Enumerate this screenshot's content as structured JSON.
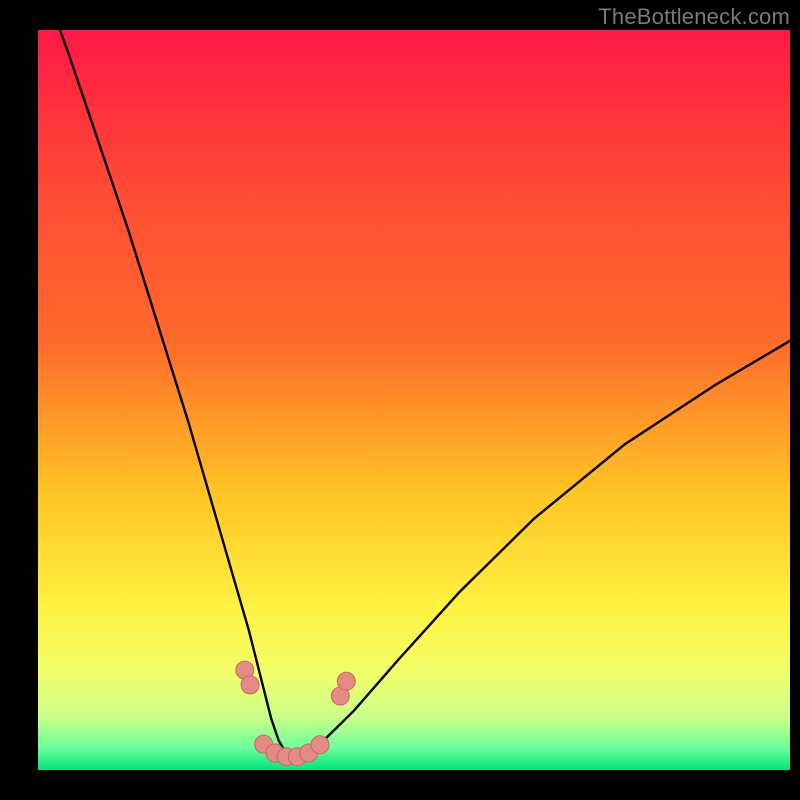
{
  "watermark": "TheBottleneck.com",
  "colors": {
    "black": "#000000",
    "grad_top": "#ff1846",
    "grad_mid1": "#ff6a2b",
    "grad_mid2": "#ffc224",
    "grad_mid3": "#fff240",
    "grad_mid4": "#f1ff6a",
    "grad_bottom1": "#c8ff8a",
    "grad_bottom2": "#6bff9a",
    "grad_bottom3": "#00e57a",
    "curve": "#000000",
    "marker_fill": "#e38b84",
    "marker_stroke": "#c86860"
  },
  "chart_data": {
    "type": "line",
    "title": "",
    "xlabel": "",
    "ylabel": "",
    "xlim": [
      0,
      100
    ],
    "ylim": [
      0,
      100
    ],
    "series": [
      {
        "name": "bottleneck-curve",
        "x": [
          0,
          4,
          8,
          12,
          16,
          20,
          24,
          26,
          28,
          30,
          31,
          32,
          33,
          34,
          35,
          36,
          38,
          42,
          48,
          56,
          66,
          78,
          90,
          100
        ],
        "y": [
          108,
          97,
          85,
          73,
          60,
          47,
          33,
          26,
          19,
          11,
          7,
          4,
          2.2,
          1.5,
          1.5,
          2,
          4,
          8,
          15,
          24,
          34,
          44,
          52,
          58
        ]
      }
    ],
    "markers": [
      {
        "x": 27.5,
        "y": 13.5
      },
      {
        "x": 28.2,
        "y": 11.5
      },
      {
        "x": 30.0,
        "y": 3.5
      },
      {
        "x": 31.5,
        "y": 2.3
      },
      {
        "x": 33.0,
        "y": 1.8
      },
      {
        "x": 34.5,
        "y": 1.8
      },
      {
        "x": 36.0,
        "y": 2.3
      },
      {
        "x": 37.5,
        "y": 3.4
      },
      {
        "x": 40.2,
        "y": 10.0
      },
      {
        "x": 41.0,
        "y": 12.0
      }
    ]
  }
}
